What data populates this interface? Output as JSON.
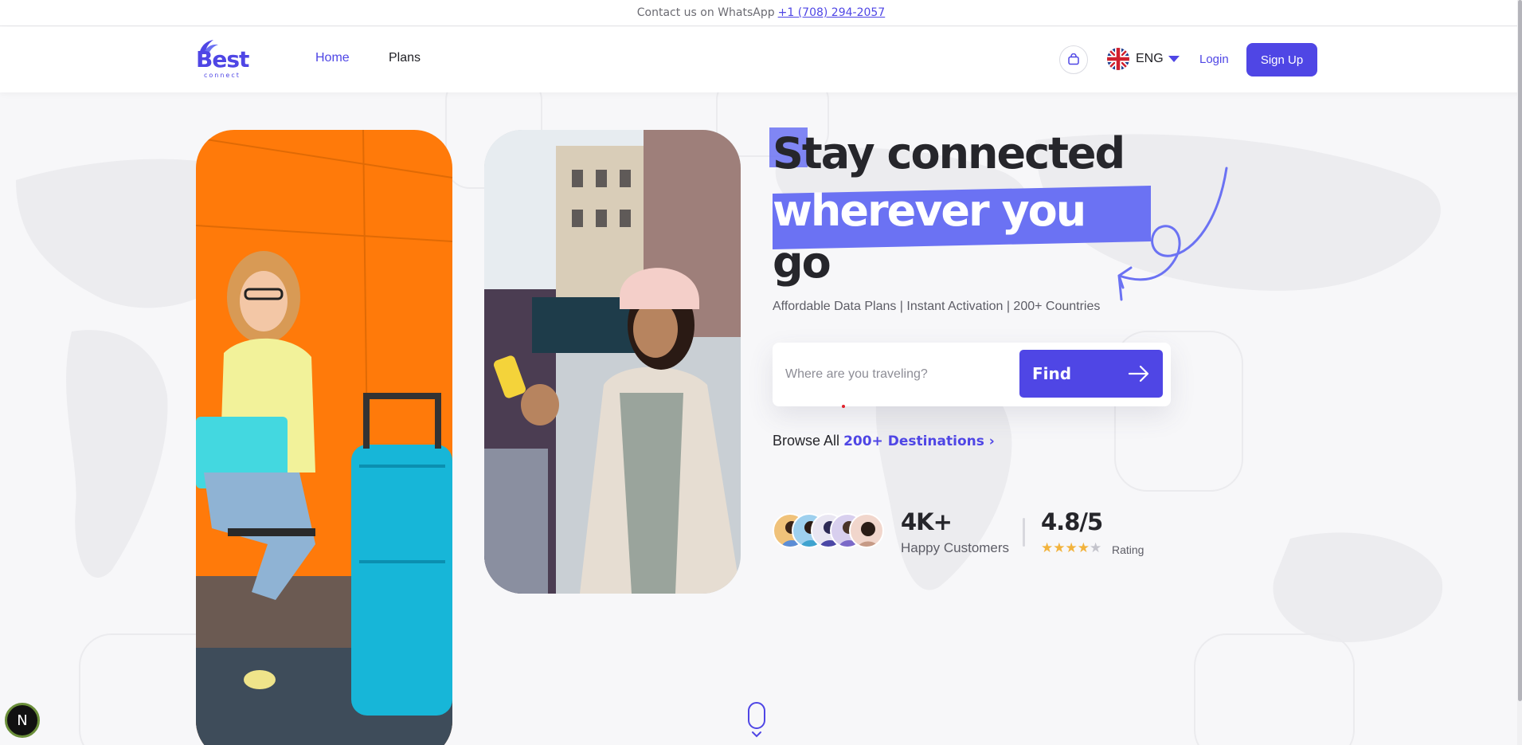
{
  "contact_bar": {
    "text": "Contact us on WhatsApp",
    "phone": "+1 (708) 294-2057"
  },
  "header": {
    "logo_text": "Best",
    "logo_sub": "connect",
    "nav": {
      "home": "Home",
      "plans": "Plans"
    },
    "language": {
      "label": "ENG",
      "flag_icon": "uk-flag-icon"
    },
    "cart_icon": "bag-icon",
    "login_label": "Login",
    "signup_label": "Sign Up"
  },
  "hero": {
    "headline_line1": "Stay connected",
    "headline_line2": "wherever you",
    "headline_line3": "go",
    "subtitle": "Affordable Data Plans | Instant Activation | 200+ Countries",
    "search": {
      "placeholder": "Where are you traveling?",
      "button_label": "Find",
      "button_icon": "arrow-right-icon"
    },
    "browse": {
      "prefix": "Browse All",
      "link": "200+ Destinations ›"
    },
    "stats": {
      "customers_value": "4K+",
      "customers_label": "Happy Customers",
      "rating_value": "4.8/5",
      "rating_label": "Rating",
      "rating_stars": 4.8
    }
  },
  "colors": {
    "brand": "#4f46e5",
    "highlight": "#6b72f3",
    "star": "#f2b33d"
  },
  "badge": {
    "label": "N"
  }
}
